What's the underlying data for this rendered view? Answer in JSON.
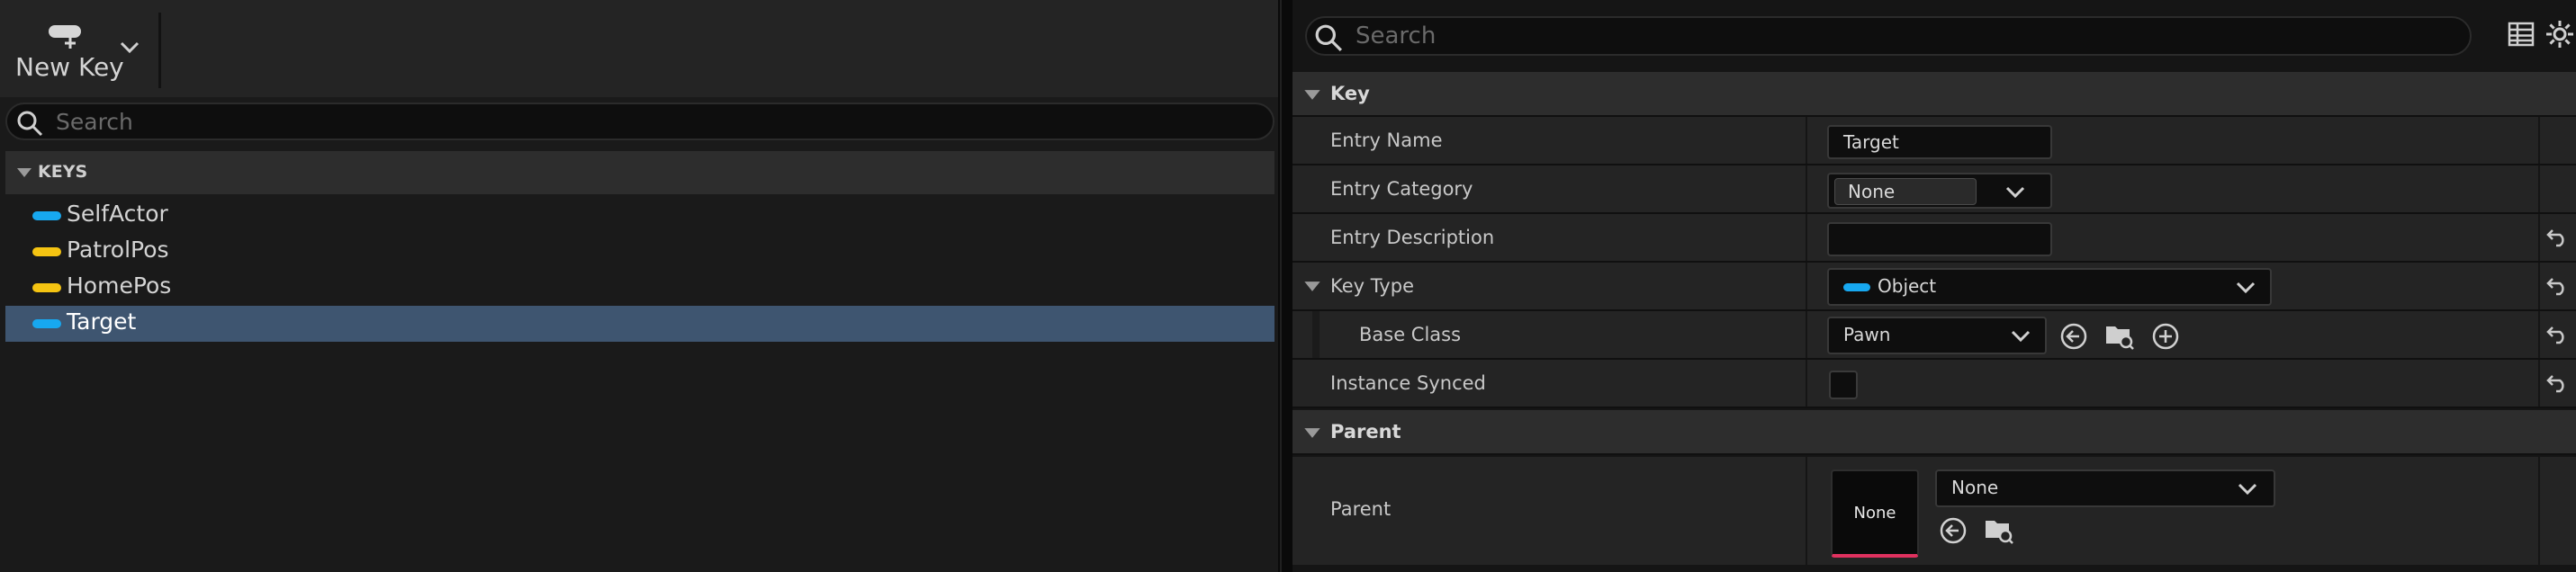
{
  "toolbar": {
    "new_key_label": "New Key"
  },
  "left_search": {
    "placeholder": "Search"
  },
  "keys": {
    "header": "KEYS",
    "items": [
      {
        "label": "SelfActor",
        "color": "#17a8f0",
        "selected": false
      },
      {
        "label": "PatrolPos",
        "color": "#f5c412",
        "selected": false
      },
      {
        "label": "HomePos",
        "color": "#f5c412",
        "selected": false
      },
      {
        "label": "Target",
        "color": "#17a8f0",
        "selected": true
      }
    ]
  },
  "details": {
    "search_placeholder": "Search",
    "key_section": {
      "title": "Key",
      "entry_name_label": "Entry Name",
      "entry_name_value": "Target",
      "entry_category_label": "Entry Category",
      "entry_category_value": "None",
      "entry_description_label": "Entry Description",
      "entry_description_value": "",
      "key_type_label": "Key Type",
      "key_type_value": "Object",
      "key_type_color": "#17a8f0",
      "base_class_label": "Base Class",
      "base_class_value": "Pawn",
      "instance_synced_label": "Instance Synced",
      "instance_synced_checked": false
    },
    "parent_section": {
      "title": "Parent",
      "parent_label": "Parent",
      "parent_value": "None",
      "thumbnail_label": "None"
    }
  },
  "colors": {
    "selection": "#3e5570",
    "accent_red": "#e0315f"
  }
}
